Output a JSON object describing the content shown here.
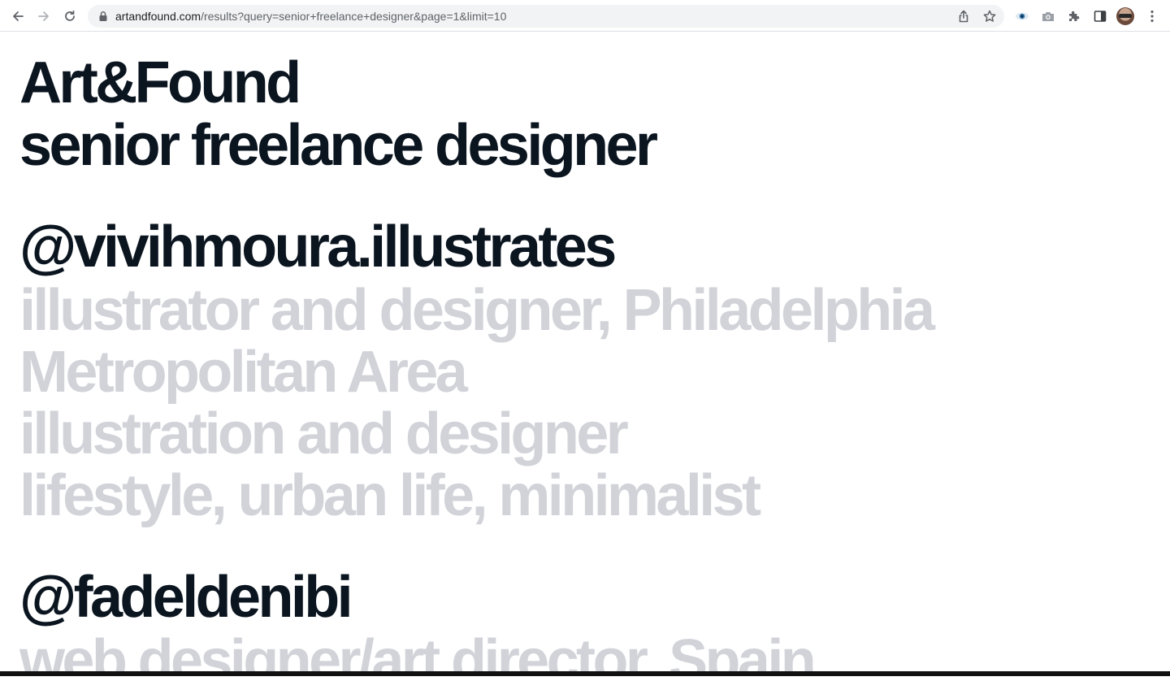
{
  "browser": {
    "url_host": "artandfound.com",
    "url_path": "/results?query=senior+freelance+designer&page=1&limit=10",
    "icons": [
      "back-arrow-icon",
      "forward-arrow-icon",
      "reload-icon",
      "lock-icon",
      "share-icon",
      "star-icon",
      "eye-extension-icon",
      "camera-extension-icon",
      "puzzle-icon",
      "side-panel-icon",
      "avatar",
      "kebab-menu-icon"
    ]
  },
  "header": {
    "brand": "Art&Found",
    "query": "senior freelance designer"
  },
  "results": [
    {
      "handle": "@vivihmoura.illustrates",
      "lines": [
        "illustrator and designer, Philadelphia",
        "Metropolitan Area",
        "illustration and designer",
        "lifestyle, urban life, minimalist"
      ]
    },
    {
      "handle": "@fadeldenibi",
      "lines": [
        "web designer/art director, Spain"
      ]
    }
  ],
  "colors": {
    "text_dark": "#0b1520",
    "text_muted": "#d1d3d9",
    "omnibox_bg": "#f1f3f4"
  }
}
